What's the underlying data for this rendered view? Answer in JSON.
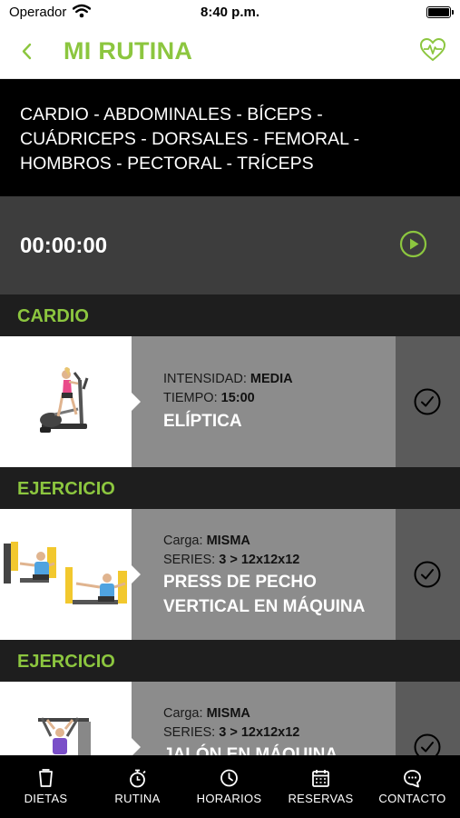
{
  "status": {
    "carrier": "Operador",
    "time": "8:40 p.m."
  },
  "nav": {
    "title": "MI RUTINA"
  },
  "routine": {
    "muscles": "CARDIO - ABDOMINALES - BÍCEPS - CUÁDRICEPS - DORSALES - FEMORAL - HOMBROS - PECTORAL - TRÍCEPS",
    "timer": "00:00:00"
  },
  "sections": [
    {
      "title": "CARDIO",
      "item": {
        "line1_label": "INTENSIDAD:",
        "line1_value": "MEDIA",
        "line2_label": "TIEMPO:",
        "line2_value": "15:00",
        "name": "ELÍPTICA",
        "icon": "elliptical-machine-photo"
      }
    },
    {
      "title": "EJERCICIO",
      "item": {
        "line1_label": "Carga:",
        "line1_value": "MISMA",
        "line2_label": "SERIES:",
        "line2_value": "3 > 12x12x12",
        "name": "PRESS DE PECHO VERTICAL EN MÁQUINA",
        "icon": "chest-press-photo"
      }
    },
    {
      "title": "EJERCICIO",
      "item": {
        "line1_label": "Carga:",
        "line1_value": "MISMA",
        "line2_label": "SERIES:",
        "line2_value": "3 > 12x12x12",
        "name": "JALÓN EN MÁQUINA",
        "icon": "lat-pulldown-photo"
      }
    }
  ],
  "tabs": [
    {
      "label": "DIETAS",
      "icon": "cup-icon"
    },
    {
      "label": "RUTINA",
      "icon": "stopwatch-icon"
    },
    {
      "label": "HORARIOS",
      "icon": "clock-icon"
    },
    {
      "label": "RESERVAS",
      "icon": "calendar-icon"
    },
    {
      "label": "CONTACTO",
      "icon": "chat-icon"
    }
  ],
  "colors": {
    "accent": "#8cc63f",
    "header_bg": "#000000",
    "timer_bg": "#3d3d3d",
    "section_bg": "#1e1e1e",
    "info_bg": "#8c8c8c",
    "check_bg": "#5b5b5b"
  }
}
